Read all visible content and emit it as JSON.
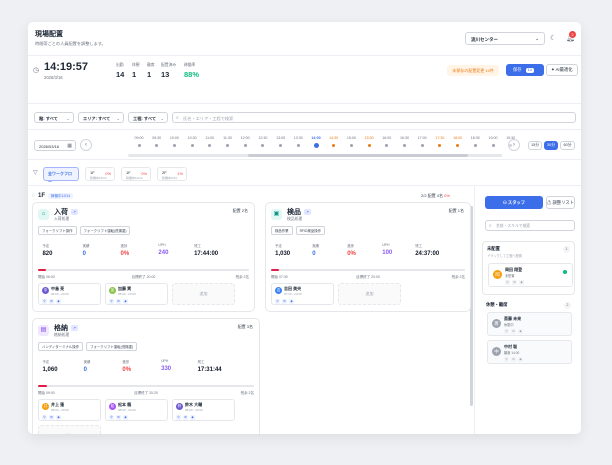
{
  "header": {
    "title": "現場配置",
    "subtitle": "時間帯ごとの人員配置を調整します。",
    "center": "流川センター",
    "notif_count": "2"
  },
  "stats": {
    "time": "14:19:57",
    "date": "2026/3/16",
    "items": [
      {
        "label": "出勤",
        "value": "14"
      },
      {
        "label": "休憩",
        "value": "1"
      },
      {
        "label": "離席",
        "value": "1"
      },
      {
        "label": "配置済み",
        "value": "13"
      },
      {
        "label": "稼働率",
        "value": "88%"
      }
    ],
    "unsaved": "未保存の配置変更 14件",
    "save_label": "保存",
    "save_count": "14",
    "ai_label": "AI最適化"
  },
  "filters": {
    "floor": "階: すべて",
    "area": "エリア: すべて",
    "process": "工程: すべて",
    "search_placeholder": "氏名・エリア・工程で検索"
  },
  "timeline": {
    "date": "2026/03/16",
    "ticks": [
      {
        "t": "09:00",
        "s": "n"
      },
      {
        "t": "09:30",
        "s": "n"
      },
      {
        "t": "10:00",
        "s": "n"
      },
      {
        "t": "10:30",
        "s": "n"
      },
      {
        "t": "11:00",
        "s": "n"
      },
      {
        "t": "11:30",
        "s": "n"
      },
      {
        "t": "12:00",
        "s": "n"
      },
      {
        "t": "12:30",
        "s": "n"
      },
      {
        "t": "13:00",
        "s": "n"
      },
      {
        "t": "13:30",
        "s": "n"
      },
      {
        "t": "14:00",
        "s": "now"
      },
      {
        "t": "14:30",
        "s": "warn"
      },
      {
        "t": "15:00",
        "s": "n"
      },
      {
        "t": "15:30",
        "s": "warn"
      },
      {
        "t": "16:00",
        "s": "n"
      },
      {
        "t": "16:30",
        "s": "n"
      },
      {
        "t": "17:00",
        "s": "n"
      },
      {
        "t": "17:30",
        "s": "warn"
      },
      {
        "t": "18:00",
        "s": "warn"
      },
      {
        "t": "18:30",
        "s": "n"
      },
      {
        "t": "19:00",
        "s": "n"
      },
      {
        "t": "19:30",
        "s": "gray"
      }
    ],
    "zoom": [
      "15分",
      "30分",
      "60分"
    ],
    "zoom_selected": "30分"
  },
  "workflow": {
    "all": "全ワークフロー",
    "floors": [
      {
        "name": "1F",
        "sub": "稼働中12/14",
        "pct": "0%"
      },
      {
        "name": "1F",
        "sub": "稼働中12/14",
        "pct": "0%"
      },
      {
        "name": "2F",
        "sub": "稼働中3/14",
        "pct": "1%"
      }
    ]
  },
  "floor": {
    "name": "1F",
    "tag": "稼働中12/14",
    "summary": "2/2 配置 4名",
    "pct": "0%"
  },
  "processes": [
    {
      "name": "入荷",
      "tag": "↗",
      "sub": "入荷処理",
      "assign": "配置 2名",
      "skills": [
        "フォークリフト操作",
        "フォークリフト運転(低揚重)"
      ],
      "metrics": [
        {
          "l": "予定",
          "v": "820"
        },
        {
          "l": "実績",
          "v": "0"
        },
        {
          "l": "進捗",
          "v": "0%"
        },
        {
          "l": "UPH",
          "v": "240"
        },
        {
          "l": "残工",
          "v": "17:44:00"
        }
      ],
      "progress": 0.04,
      "start": "開始 06:00",
      "mid": "目標終了 20:00",
      "end": "残余 2名",
      "workers": [
        {
          "name": "中島 亮",
          "time": "08:00 - 20:00",
          "color": "#6d5bd0",
          "ini": "中"
        },
        {
          "name": "加藤 実",
          "time": "08:00 - 20:00",
          "color": "#8bc34a",
          "ini": "加"
        }
      ],
      "add": "追加"
    },
    {
      "name": "検品",
      "tag": "↗",
      "sub": "検品処理",
      "assign": "配置 1名",
      "skills": [
        "検品作業",
        "RFID検品操作"
      ],
      "metrics": [
        {
          "l": "予定",
          "v": "1,030"
        },
        {
          "l": "実績",
          "v": "0"
        },
        {
          "l": "進捗",
          "v": "0%"
        },
        {
          "l": "UPH",
          "v": "100"
        },
        {
          "l": "残工",
          "v": "24:37:00"
        }
      ],
      "progress": 0.04,
      "start": "開始 07:30",
      "mid": "目標終了 20:00",
      "end": "残余 2名",
      "workers": [
        {
          "name": "吉田 美央",
          "time": "07:30 - 20:00",
          "color": "#3b82f6",
          "ini": "吉"
        }
      ],
      "add": "追加"
    },
    {
      "name": "格納",
      "tag": "↗",
      "sub": "格納処理",
      "assign": "配置 3名",
      "skills": [
        "ハンディターミナル操作",
        "フォークリフト運転(低揚重)"
      ],
      "metrics": [
        {
          "l": "予定",
          "v": "1,060"
        },
        {
          "l": "実績",
          "v": "0"
        },
        {
          "l": "進捗",
          "v": "0%"
        },
        {
          "l": "UPH",
          "v": "330"
        },
        {
          "l": "残工",
          "v": "17:31:44"
        }
      ],
      "progress": 0.04,
      "start": "開始 09:00",
      "mid": "目標終了 20:20",
      "end": "残余 2名",
      "workers": [
        {
          "name": "井上 蓮",
          "time": "08:00 - 20:00",
          "color": "#f59e0b",
          "ini": "井"
        },
        {
          "name": "松本 楓",
          "time": "08:00 - 20:00",
          "color": "#a855f7",
          "ini": "松"
        },
        {
          "name": "鈴木 大輔",
          "time": "08:00 - 20:00",
          "color": "#6d5bd0",
          "ini": "鈴"
        }
      ],
      "add": "追加"
    }
  ],
  "side": {
    "tab_staff": "スタッフ",
    "tab_request": "調整リスト",
    "search_placeholder": "名前・スキルで検索",
    "unassigned": {
      "title": "未配置",
      "hint": "ドラッグして工程へ配置",
      "count": "1",
      "workers": [
        {
          "name": "岡田 翔登",
          "sub": "未配置",
          "color": "#f59e0b",
          "ini": "岡"
        }
      ]
    },
    "break": {
      "title": "休憩・離席",
      "count": "2",
      "workers": [
        {
          "name": "斎藤 未来",
          "sub": "休憩中",
          "color": "#9ca3af",
          "ini": "斎"
        },
        {
          "name": "中村 聡",
          "sub": "離席 14:00",
          "color": "#9ca3af",
          "ini": "中"
        }
      ]
    }
  }
}
